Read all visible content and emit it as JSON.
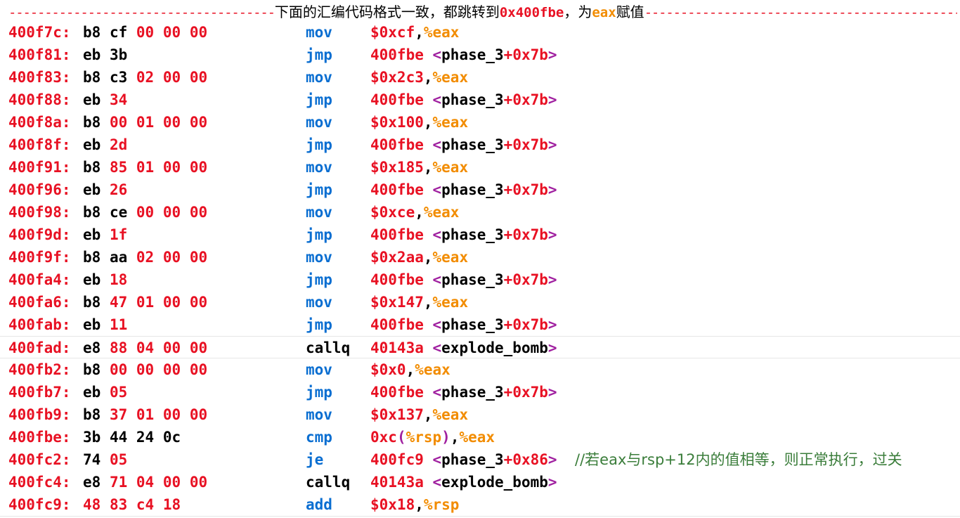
{
  "header": {
    "dashes_left": "-------------------------------------",
    "text_1": "下面的汇编代码格式一致，都跳转到",
    "addr": "0x400fbe",
    "text_2": "，为",
    "reg": "eax",
    "text_3": "赋值",
    "dashes_right": "-----------------------------------------------------"
  },
  "rows": [
    {
      "addr": "400f7c:",
      "bytes": [
        "b8",
        "cf",
        "00",
        "00",
        "00"
      ],
      "mnemonic": "mov",
      "op_a": "$0xcf",
      "op_b": ",",
      "op_c": "%eax",
      "op_d": "",
      "op_e": "",
      "op_f": ""
    },
    {
      "addr": "400f81:",
      "bytes": [
        "eb",
        "3b"
      ],
      "mnemonic": "jmp",
      "op_a": "400fbe",
      "op_b": " <",
      "op_c": "phase_3",
      "op_d": "+0x7b",
      "op_e": ">",
      "op_f": ""
    },
    {
      "addr": "400f83:",
      "bytes": [
        "b8",
        "c3",
        "02",
        "00",
        "00"
      ],
      "mnemonic": "mov",
      "op_a": "$0x2c3",
      "op_b": ",",
      "op_c": "%eax",
      "op_d": "",
      "op_e": "",
      "op_f": ""
    },
    {
      "addr": "400f88:",
      "bytes": [
        "eb",
        "34"
      ],
      "mnemonic": "jmp",
      "op_a": "400fbe",
      "op_b": " <",
      "op_c": "phase_3",
      "op_d": "+0x7b",
      "op_e": ">",
      "op_f": ""
    },
    {
      "addr": "400f8a:",
      "bytes": [
        "b8",
        "00",
        "01",
        "00",
        "00"
      ],
      "mnemonic": "mov",
      "op_a": "$0x100",
      "op_b": ",",
      "op_c": "%eax",
      "op_d": "",
      "op_e": "",
      "op_f": ""
    },
    {
      "addr": "400f8f:",
      "bytes": [
        "eb",
        "2d"
      ],
      "mnemonic": "jmp",
      "op_a": "400fbe",
      "op_b": " <",
      "op_c": "phase_3",
      "op_d": "+0x7b",
      "op_e": ">",
      "op_f": ""
    },
    {
      "addr": "400f91:",
      "bytes": [
        "b8",
        "85",
        "01",
        "00",
        "00"
      ],
      "mnemonic": "mov",
      "op_a": "$0x185",
      "op_b": ",",
      "op_c": "%eax",
      "op_d": "",
      "op_e": "",
      "op_f": ""
    },
    {
      "addr": "400f96:",
      "bytes": [
        "eb",
        "26"
      ],
      "mnemonic": "jmp",
      "op_a": "400fbe",
      "op_b": " <",
      "op_c": "phase_3",
      "op_d": "+0x7b",
      "op_e": ">",
      "op_f": ""
    },
    {
      "addr": "400f98:",
      "bytes": [
        "b8",
        "ce",
        "00",
        "00",
        "00"
      ],
      "mnemonic": "mov",
      "op_a": "$0xce",
      "op_b": ",",
      "op_c": "%eax",
      "op_d": "",
      "op_e": "",
      "op_f": ""
    },
    {
      "addr": "400f9d:",
      "bytes": [
        "eb",
        "1f"
      ],
      "mnemonic": "jmp",
      "op_a": "400fbe",
      "op_b": " <",
      "op_c": "phase_3",
      "op_d": "+0x7b",
      "op_e": ">",
      "op_f": ""
    },
    {
      "addr": "400f9f:",
      "bytes": [
        "b8",
        "aa",
        "02",
        "00",
        "00"
      ],
      "mnemonic": "mov",
      "op_a": "$0x2aa",
      "op_b": ",",
      "op_c": "%eax",
      "op_d": "",
      "op_e": "",
      "op_f": ""
    },
    {
      "addr": "400fa4:",
      "bytes": [
        "eb",
        "18"
      ],
      "mnemonic": "jmp",
      "op_a": "400fbe",
      "op_b": " <",
      "op_c": "phase_3",
      "op_d": "+0x7b",
      "op_e": ">",
      "op_f": ""
    },
    {
      "addr": "400fa6:",
      "bytes": [
        "b8",
        "47",
        "01",
        "00",
        "00"
      ],
      "mnemonic": "mov",
      "op_a": "$0x147",
      "op_b": ",",
      "op_c": "%eax",
      "op_d": "",
      "op_e": "",
      "op_f": ""
    },
    {
      "addr": "400fab:",
      "bytes": [
        "eb",
        "11"
      ],
      "mnemonic": "jmp",
      "op_a": "400fbe",
      "op_b": " <",
      "op_c": "phase_3",
      "op_d": "+0x7b",
      "op_e": ">",
      "op_f": ""
    },
    {
      "addr": "400fad:",
      "bytes": [
        "e8",
        "88",
        "04",
        "00",
        "00"
      ],
      "mnemonic": "callq",
      "op_a": "40143a",
      "op_b": " <",
      "op_c": "explode_bomb",
      "op_d": "",
      "op_e": ">",
      "op_f": ""
    },
    {
      "addr": "400fb2:",
      "bytes": [
        "b8",
        "00",
        "00",
        "00",
        "00"
      ],
      "mnemonic": "mov",
      "op_a": "$0x0",
      "op_b": ",",
      "op_c": "%eax",
      "op_d": "",
      "op_e": "",
      "op_f": ""
    },
    {
      "addr": "400fb7:",
      "bytes": [
        "eb",
        "05"
      ],
      "mnemonic": "jmp",
      "op_a": "400fbe",
      "op_b": " <",
      "op_c": "phase_3",
      "op_d": "+0x7b",
      "op_e": ">",
      "op_f": ""
    },
    {
      "addr": "400fb9:",
      "bytes": [
        "b8",
        "37",
        "01",
        "00",
        "00"
      ],
      "mnemonic": "mov",
      "op_a": "$0x137",
      "op_b": ",",
      "op_c": "%eax",
      "op_d": "",
      "op_e": "",
      "op_f": ""
    },
    {
      "addr": "400fbe:",
      "bytes": [
        "3b",
        "44",
        "24",
        "0c"
      ],
      "mnemonic": "cmp",
      "op_a": "0xc",
      "op_b": "(",
      "op_c": "%rsp",
      "op_d": ")",
      "op_e": ",",
      "op_f": "%eax"
    },
    {
      "addr": "400fc2:",
      "bytes": [
        "74",
        "05"
      ],
      "mnemonic": "je",
      "op_a": "400fc9",
      "op_b": " <",
      "op_c": "phase_3",
      "op_d": "+0x86",
      "op_e": ">",
      "op_f": ""
    },
    {
      "addr": "400fc4:",
      "bytes": [
        "e8",
        "71",
        "04",
        "00",
        "00"
      ],
      "mnemonic": "callq",
      "op_a": "40143a",
      "op_b": " <",
      "op_c": "explode_bomb",
      "op_d": "",
      "op_e": ">",
      "op_f": ""
    },
    {
      "addr": "400fc9:",
      "bytes": [
        "48",
        "83",
        "c4",
        "18"
      ],
      "mnemonic": "add",
      "op_a": "$0x18",
      "op_b": ",",
      "op_c": "%rsp",
      "op_d": "",
      "op_e": "",
      "op_f": ""
    }
  ],
  "comment": "//若eax与rsp+12内的值相等，则正常执行，过关",
  "colors": {
    "address": "#e81123",
    "mnemonic": "#0a6ed1",
    "register": "#f28c00",
    "bracket": "#a020a0",
    "comment": "#3a7d3a"
  }
}
